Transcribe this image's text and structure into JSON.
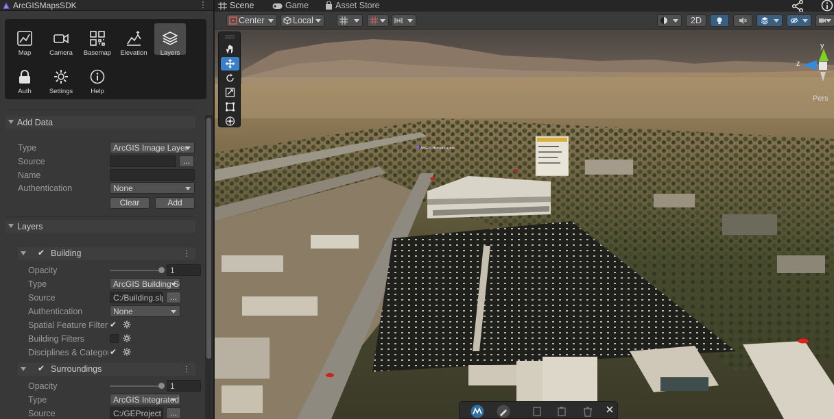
{
  "left_panel": {
    "window_title": "ArcGISMapsSDK",
    "toolbox": [
      {
        "label": "Map",
        "icon": "map-icon"
      },
      {
        "label": "Camera",
        "icon": "camera-icon"
      },
      {
        "label": "Basemap",
        "icon": "basemap-icon"
      },
      {
        "label": "Elevation",
        "icon": "elevation-icon"
      },
      {
        "label": "Layers",
        "icon": "layers-icon",
        "active": true
      },
      {
        "label": "Auth",
        "icon": "lock-icon"
      },
      {
        "label": "Settings",
        "icon": "gear-icon"
      },
      {
        "label": "Help",
        "icon": "info-icon"
      }
    ],
    "add_data": {
      "title": "Add Data",
      "type_label": "Type",
      "type_value": "ArcGIS Image Layer",
      "source_label": "Source",
      "source_value": "",
      "name_label": "Name",
      "name_value": "",
      "auth_label": "Authentication",
      "auth_value": "None",
      "browse_label": "...",
      "clear_label": "Clear",
      "add_label": "Add"
    },
    "layers": {
      "title": "Layers",
      "items": [
        {
          "name": "Building",
          "checked": true,
          "opacity_label": "Opacity",
          "opacity_value": "1",
          "type_label": "Type",
          "type_value": "ArcGIS Building Scene Layer",
          "source_label": "Source",
          "source_value": "C:/Building.slpk",
          "browse_label": "...",
          "auth_label": "Authentication",
          "auth_value": "None",
          "spatial_label": "Spatial Feature Filter",
          "spatial_checked": true,
          "building_filters_label": "Building Filters",
          "building_filters_checked": false,
          "disciplines_label": "Disciplines & Categories",
          "disciplines_checked": true
        },
        {
          "name": "Surroundings",
          "checked": true,
          "opacity_label": "Opacity",
          "opacity_value": "1",
          "type_label": "Type",
          "type_value": "ArcGIS Integrated Mesh Layer",
          "source_label": "Source",
          "source_value": "C:/GEProject",
          "browse_label": "..."
        }
      ]
    }
  },
  "scene": {
    "tabs": [
      {
        "label": "Scene",
        "icon": "grid-icon",
        "active": true
      },
      {
        "label": "Game",
        "icon": "gamepad-icon"
      },
      {
        "label": "Asset Store",
        "icon": "bag-icon"
      }
    ],
    "toolbar": {
      "pivot_mode": "Center",
      "pivot_rotation": "Local",
      "mode_2d": "2D"
    },
    "axis": {
      "y": "y",
      "z": "z",
      "persp": "Pers"
    },
    "viewport_label": "ArcGIS Hosted Layers"
  },
  "colors": {
    "accent_blue": "#3b80c6",
    "panel_bg": "#383838",
    "toolbox_bg": "#1d1d1d"
  }
}
